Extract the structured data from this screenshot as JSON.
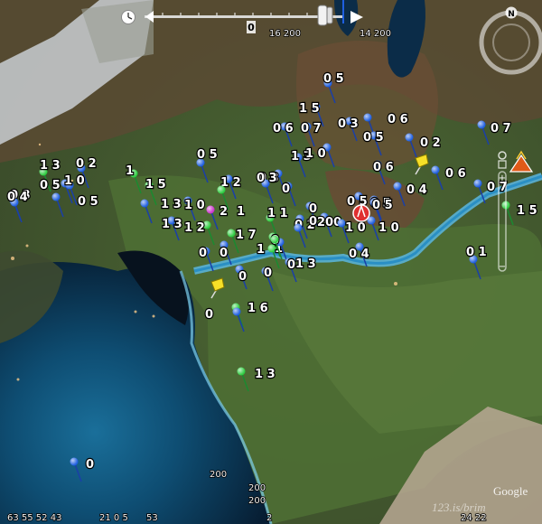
{
  "timeline": {
    "clock_icon": "clock-icon",
    "start_label": "16 200",
    "end_label": "14 200",
    "marker_label": "0"
  },
  "navigation": {
    "compass_letter": "N",
    "zoom_plus": "+",
    "zoom_minus": "−"
  },
  "placemarks": [
    {
      "label": "0 5",
      "color": "#1f5fe0"
    },
    {
      "label": "1 5",
      "color": "#1f5fe0"
    },
    {
      "label": "0 6",
      "color": "#1f5fe0"
    },
    {
      "label": "0 7",
      "color": "#1f5fe0"
    },
    {
      "label": "0 3",
      "color": "#1f5fe0"
    },
    {
      "label": "0 6",
      "color": "#1f5fe0"
    },
    {
      "label": "0 5",
      "color": "#1f5fe0"
    },
    {
      "label": "0 2",
      "color": "#1f5fe0"
    },
    {
      "label": "0 7",
      "color": "#1f5fe0"
    },
    {
      "label": "1 3",
      "color": "#2ecc40"
    },
    {
      "label": "0 2",
      "color": "#1f5fe0"
    },
    {
      "label": "0 5",
      "color": "#1f5fe0"
    },
    {
      "label": "1 3",
      "color": "#1f5fe0"
    },
    {
      "label": "1 0",
      "color": "#1f5fe0"
    },
    {
      "label": "0 6",
      "color": "#1f5fe0"
    },
    {
      "label": "0 6",
      "color": "#1f5fe0"
    },
    {
      "label": "0 3",
      "color": "#1f5fe0"
    },
    {
      "label": "0 5",
      "color": "#1f5fe0"
    },
    {
      "label": "1 0",
      "color": "#1f5fe0"
    },
    {
      "label": "1",
      "color": "#2ecc40"
    },
    {
      "label": "1 5",
      "color": "#2ecc40"
    },
    {
      "label": "1 2",
      "color": "#1f5fe0"
    },
    {
      "label": "0 3",
      "color": "#1f5fe0"
    },
    {
      "label": "0 3",
      "color": "#1f5fe0"
    },
    {
      "label": "0 4",
      "color": "#1f5fe0"
    },
    {
      "label": "0 7",
      "color": "#1f5fe0"
    },
    {
      "label": "0 5",
      "color": "#1f5fe0"
    },
    {
      "label": "0 5",
      "color": "#1f5fe0"
    },
    {
      "label": "0 4",
      "color": "#1f5fe0"
    },
    {
      "label": "1 5",
      "color": "#2ecc40"
    },
    {
      "label": "1 3",
      "color": "#1f5fe0"
    },
    {
      "label": "1 0",
      "color": "#1f5fe0"
    },
    {
      "label": "2",
      "color": "#cc33cc"
    },
    {
      "label": "1",
      "color": "#2ecc40"
    },
    {
      "label": "0",
      "color": "#1f5fe0"
    },
    {
      "label": "0 5",
      "color": "#1f5fe0"
    },
    {
      "label": "0 5",
      "color": "#1f5fe0"
    },
    {
      "label": "1 3",
      "color": "#1f5fe0"
    },
    {
      "label": "1 2",
      "color": "#2ecc40"
    },
    {
      "label": "1 1",
      "color": "#2ecc40"
    },
    {
      "label": "0 2",
      "color": "#1f5fe0"
    },
    {
      "label": "200",
      "color": "#1f5fe0"
    },
    {
      "label": "0",
      "color": "#1f5fe0"
    },
    {
      "label": "1 0",
      "color": "#1f5fe0"
    },
    {
      "label": "1 0",
      "color": "#1f5fe0"
    },
    {
      "label": "1 7",
      "color": "#2ecc40"
    },
    {
      "label": "0",
      "color": "#1f5fe0"
    },
    {
      "label": "1",
      "color": "#2ecc40"
    },
    {
      "label": "1",
      "color": "#2ecc40"
    },
    {
      "label": "0",
      "color": "#1f5fe0"
    },
    {
      "label": "0 4",
      "color": "#1f5fe0"
    },
    {
      "label": "0 1",
      "color": "#1f5fe0"
    },
    {
      "label": "0",
      "color": "#1f5fe0"
    },
    {
      "label": "0",
      "color": "#1f5fe0"
    },
    {
      "label": "0",
      "color": "#1f5fe0"
    },
    {
      "label": "0",
      "color": "#1f5fe0"
    },
    {
      "label": "0",
      "color": "#1f5fe0"
    },
    {
      "label": "1 6",
      "color": "#2ecc40"
    },
    {
      "label": "1 3",
      "color": "#2ecc40"
    },
    {
      "label": "0",
      "color": "#1f5fe0"
    },
    {
      "label": "1 3",
      "color": "#2ecc40"
    },
    {
      "label": "0",
      "color": "#1f5fe0"
    }
  ],
  "bottom_numbers": [
    "63 55 52 43",
    "21 0 5",
    "53",
    "2",
    "24 22"
  ],
  "scatter_numbers": [
    "200",
    "200",
    "200"
  ],
  "attribution": {
    "provider": "Google",
    "watermark": "123.is/brim"
  },
  "colors": {
    "blue_pin": "#1f5fe0",
    "green_pin": "#2ecc40",
    "magenta_pin": "#cc33cc",
    "water": "#2a8fc4",
    "sea": "#0d4d73"
  }
}
